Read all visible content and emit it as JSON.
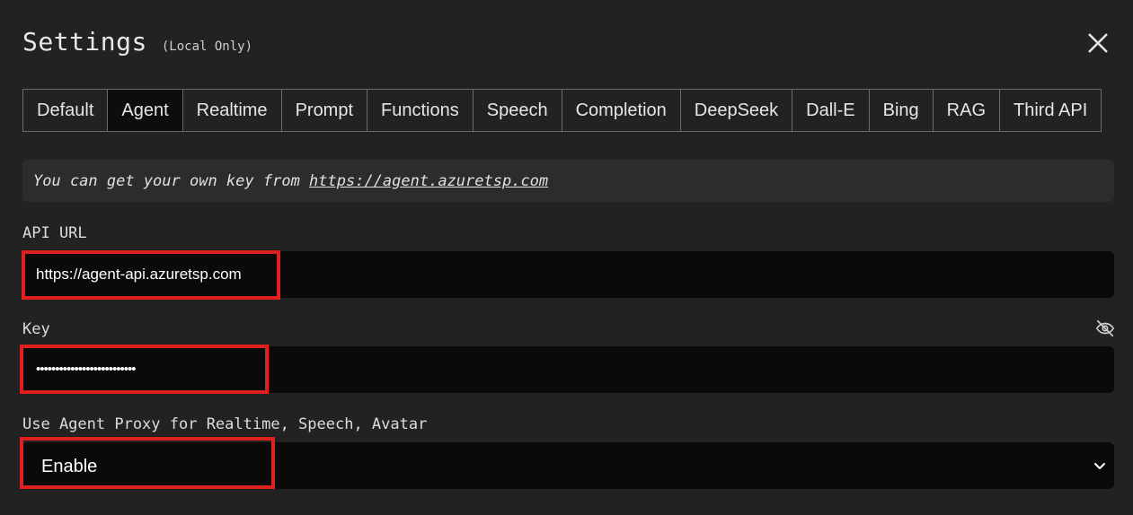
{
  "header": {
    "title": "Settings",
    "subtitle": "(Local Only)",
    "close_icon": "close-icon"
  },
  "tabs": [
    {
      "label": "Default",
      "active": false
    },
    {
      "label": "Agent",
      "active": true
    },
    {
      "label": "Realtime",
      "active": false
    },
    {
      "label": "Prompt",
      "active": false
    },
    {
      "label": "Functions",
      "active": false
    },
    {
      "label": "Speech",
      "active": false
    },
    {
      "label": "Completion",
      "active": false
    },
    {
      "label": "DeepSeek",
      "active": false
    },
    {
      "label": "Dall-E",
      "active": false
    },
    {
      "label": "Bing",
      "active": false
    },
    {
      "label": "RAG",
      "active": false
    },
    {
      "label": "Third API",
      "active": false
    }
  ],
  "info": {
    "text": "You can get your own key from ",
    "link": "https://agent.azuretsp.com"
  },
  "api_url": {
    "label": "API URL",
    "value": "https://agent-api.azuretsp.com"
  },
  "key": {
    "label": "Key",
    "value": "••••••••••••••••••••••••••",
    "toggle_icon": "eye-off-icon"
  },
  "proxy": {
    "label": "Use Agent Proxy for Realtime, Speech, Avatar",
    "selected": "Enable",
    "chevron_icon": "chevron-down-icon"
  },
  "colors": {
    "background": "#222222",
    "field_background": "#0a0a0a",
    "info_background": "#2c2c2c",
    "highlight": "#e0201f"
  }
}
